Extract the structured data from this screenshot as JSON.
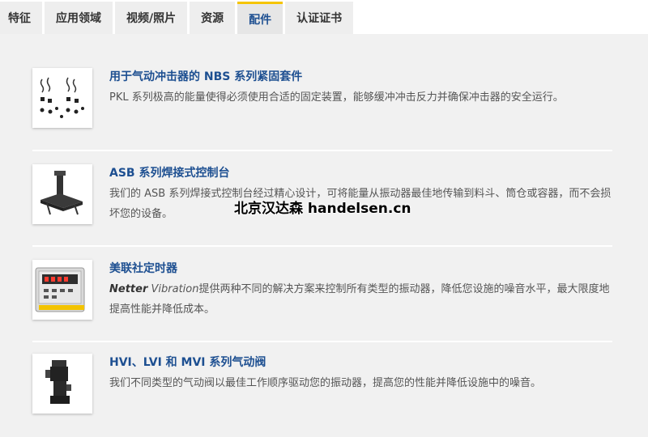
{
  "tabs": [
    {
      "label": "特征",
      "active": false
    },
    {
      "label": "应用领域",
      "active": false
    },
    {
      "label": "视频/照片",
      "active": false
    },
    {
      "label": "资源",
      "active": false
    },
    {
      "label": "配件",
      "active": true
    },
    {
      "label": "认证证书",
      "active": false
    }
  ],
  "colors": {
    "accent": "#1d4f91",
    "active_tab_border": "#f5c400",
    "panel_bg": "#f1f1f1",
    "tab_bg": "#eeeeee"
  },
  "accessories": [
    {
      "title": "用于气动冲击器的 NBS 系列紧固套件",
      "description": "PKL 系列极高的能量使得必须使用合适的固定装置，能够缓冲冲击反力并确保冲击器的安全运行。",
      "icon": "fastening-kit-icon"
    },
    {
      "title": "ASB 系列焊接式控制台",
      "description": "我们的 ASB 系列焊接式控制台经过精心设计，可将能量从振动器最佳地传输到料斗、筒仓或容器，而不会损坏您的设备。",
      "icon": "welded-bracket-icon"
    },
    {
      "title": "美联社定时器",
      "brand_bold": "Netter",
      "brand_italic": "Vibration",
      "description": "提供两种不同的解决方案来控制所有类型的振动器，降低您设施的噪音水平，最大限度地提高性能并降低成本。",
      "icon": "timer-controller-icon"
    },
    {
      "title": "HVI、LVI 和 MVI 系列气动阀",
      "description": "我们不同类型的气动阀以最佳工作顺序驱动您的振动器，提高您的性能并降低设施中的噪音。",
      "icon": "pneumatic-valve-icon"
    }
  ],
  "watermark": "北京汉达森 handelsen.cn"
}
